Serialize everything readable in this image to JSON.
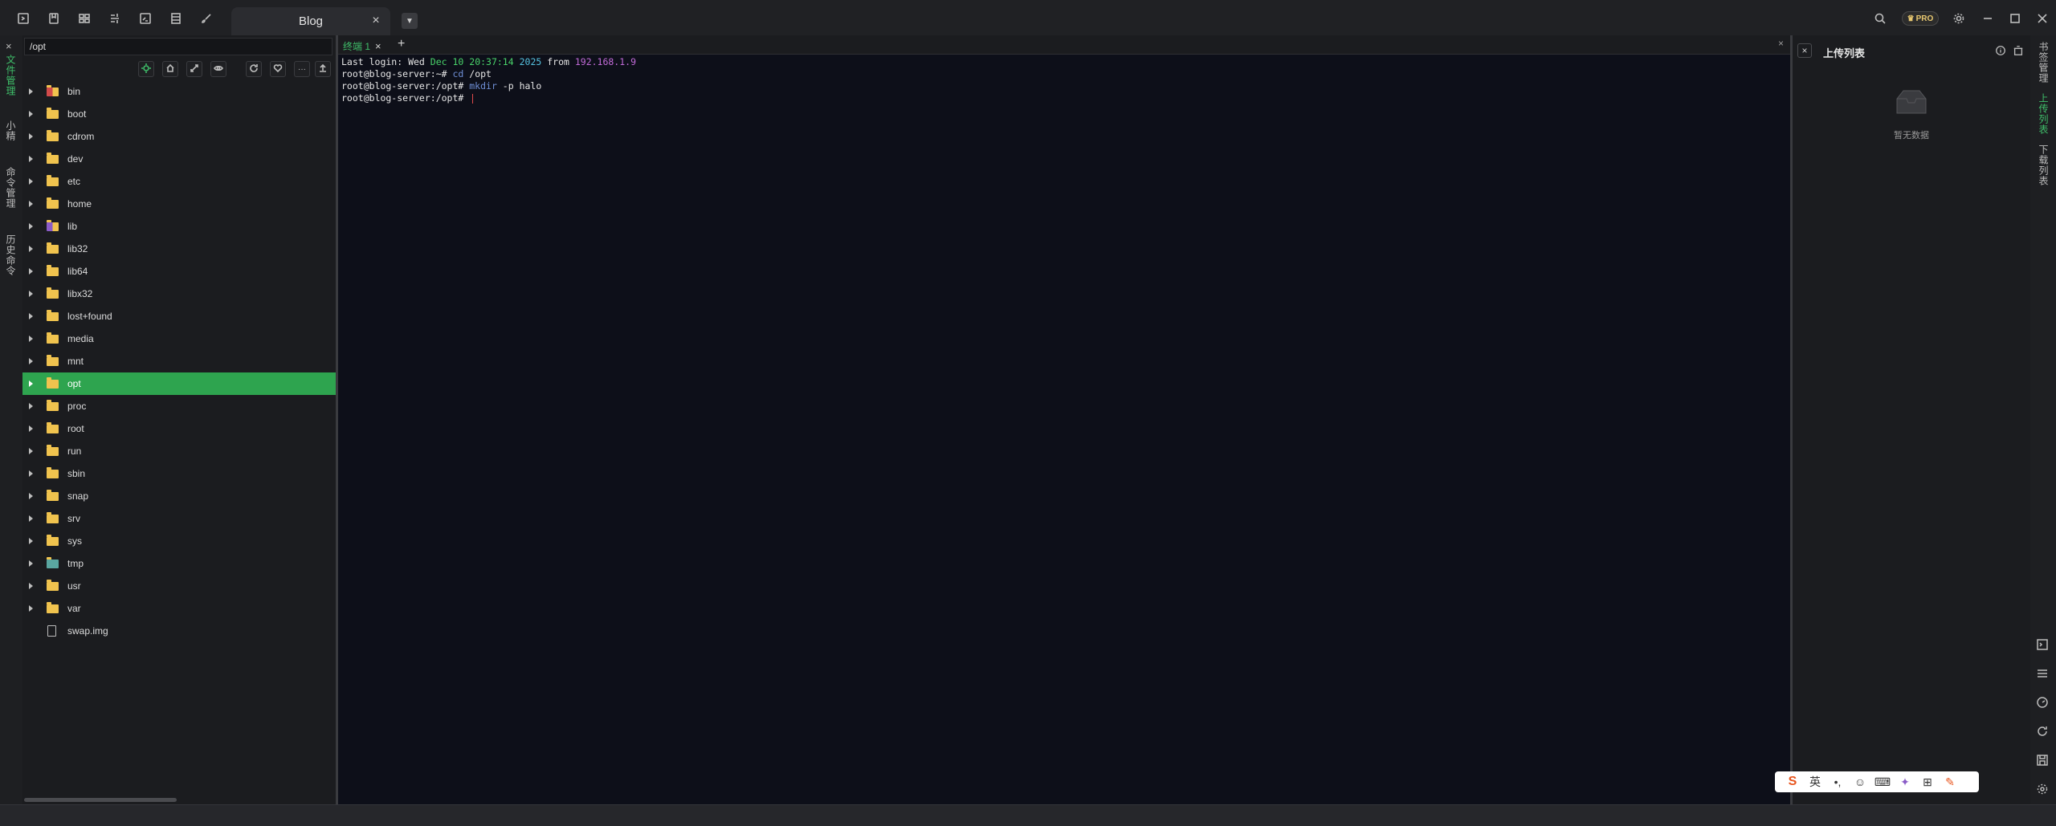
{
  "titlebar": {
    "session_tab_title": "Blog",
    "pro_label": "PRO",
    "icons": [
      "new-session-icon",
      "bookmark-icon",
      "split-icon",
      "sftp-icon",
      "terminal-icon",
      "list-icon",
      "brush-icon"
    ]
  },
  "left_sidebar": {
    "tabs": [
      {
        "label": "文件管理",
        "active": true
      },
      {
        "label": "小精",
        "active": false
      },
      {
        "label": "命令管理",
        "active": false
      },
      {
        "label": "历史命令",
        "active": false
      }
    ]
  },
  "file_panel": {
    "path": "/opt",
    "entries": [
      {
        "name": "bin",
        "type": "link"
      },
      {
        "name": "boot",
        "type": "folder"
      },
      {
        "name": "cdrom",
        "type": "folder"
      },
      {
        "name": "dev",
        "type": "folder"
      },
      {
        "name": "etc",
        "type": "folder"
      },
      {
        "name": "home",
        "type": "folder"
      },
      {
        "name": "lib",
        "type": "lib"
      },
      {
        "name": "lib32",
        "type": "folder"
      },
      {
        "name": "lib64",
        "type": "folder"
      },
      {
        "name": "libx32",
        "type": "folder"
      },
      {
        "name": "lost+found",
        "type": "folder"
      },
      {
        "name": "media",
        "type": "folder"
      },
      {
        "name": "mnt",
        "type": "folder"
      },
      {
        "name": "opt",
        "type": "folder",
        "selected": true
      },
      {
        "name": "proc",
        "type": "folder"
      },
      {
        "name": "root",
        "type": "folder"
      },
      {
        "name": "run",
        "type": "folder"
      },
      {
        "name": "sbin",
        "type": "folder"
      },
      {
        "name": "snap",
        "type": "folder"
      },
      {
        "name": "srv",
        "type": "folder"
      },
      {
        "name": "sys",
        "type": "folder"
      },
      {
        "name": "tmp",
        "type": "tmp"
      },
      {
        "name": "usr",
        "type": "folder"
      },
      {
        "name": "var",
        "type": "folder"
      },
      {
        "name": "swap.img",
        "type": "file"
      }
    ]
  },
  "terminal": {
    "tab_label": "终端 1",
    "lines": {
      "l1_prefix": "Last login: Wed ",
      "l1_date": "Dec 10",
      "l1_time": "20:37:14",
      "l1_year": "2025",
      "l1_from": " from ",
      "l1_ip": "192.168.1.9",
      "l2_prompt": "root@blog-server:~# ",
      "l2_cmd": "cd",
      "l2_arg": " /opt",
      "l3_prompt": "root@blog-server:/opt# ",
      "l3_cmd": "mkdir",
      "l3_arg": " -p halo",
      "l4_prompt": "root@blog-server:/opt# "
    }
  },
  "upload_panel": {
    "title": "上传列表",
    "empty_text": "暂无数据"
  },
  "right_sidebar": {
    "tabs": [
      {
        "label": "书签管理",
        "active": false
      },
      {
        "label": "上传列表",
        "active": true
      },
      {
        "label": "下载列表",
        "active": false
      }
    ]
  },
  "ime": {
    "logo": "S",
    "lang": "英",
    "items": [
      "punct-icon",
      "emoji-icon",
      "keyboard-icon",
      "skin-icon",
      "grid-icon",
      "tool-icon"
    ]
  }
}
